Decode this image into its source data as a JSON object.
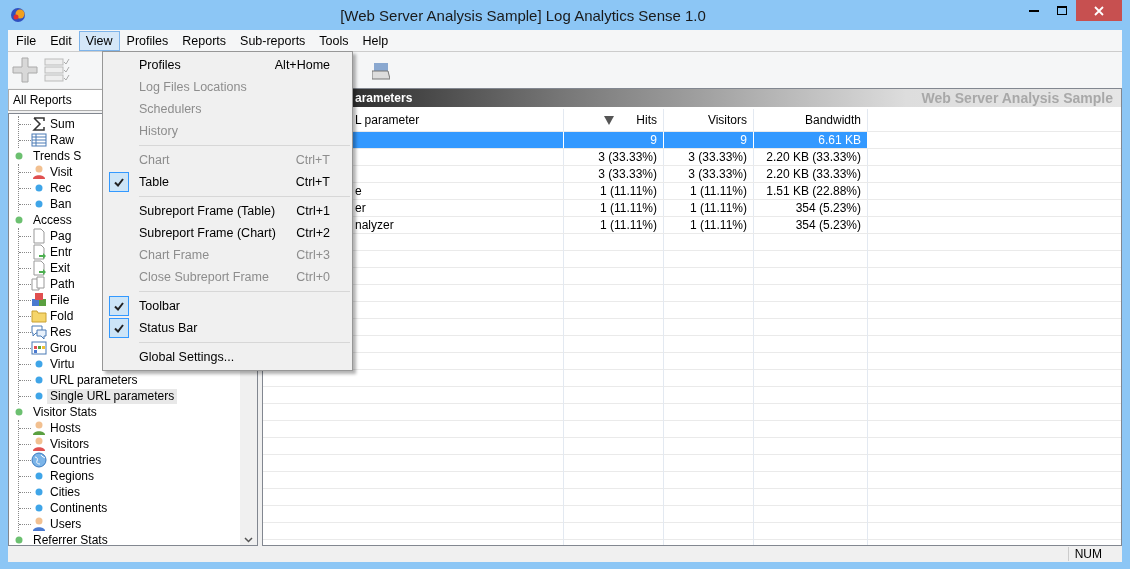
{
  "window": {
    "title": "[Web Server Analysis Sample] Log Analytics Sense 1.0"
  },
  "menubar": [
    {
      "label": "File",
      "selected": false
    },
    {
      "label": "Edit",
      "selected": false
    },
    {
      "label": "View",
      "selected": true
    },
    {
      "label": "Profiles",
      "selected": false
    },
    {
      "label": "Reports",
      "selected": false
    },
    {
      "label": "Sub-reports",
      "selected": false
    },
    {
      "label": "Tools",
      "selected": false
    },
    {
      "label": "Help",
      "selected": false
    }
  ],
  "view_menu": [
    {
      "kind": "item",
      "label": "Profiles",
      "shortcut": "Alt+Home",
      "disabled": false,
      "checked": false
    },
    {
      "kind": "item",
      "label": "Log Files Locations",
      "disabled": true,
      "checked": false
    },
    {
      "kind": "item",
      "label": "Schedulers",
      "disabled": true,
      "checked": false
    },
    {
      "kind": "item",
      "label": "History",
      "disabled": true,
      "checked": false
    },
    {
      "kind": "separator"
    },
    {
      "kind": "item",
      "label": "Chart",
      "shortcut": "Ctrl+T",
      "disabled": true,
      "checked": false
    },
    {
      "kind": "item",
      "label": "Table",
      "shortcut": "Ctrl+T",
      "disabled": false,
      "checked": true
    },
    {
      "kind": "separator"
    },
    {
      "kind": "item",
      "label": "Subreport Frame (Table)",
      "shortcut": "Ctrl+1",
      "disabled": false,
      "checked": false
    },
    {
      "kind": "item",
      "label": "Subreport Frame (Chart)",
      "shortcut": "Ctrl+2",
      "disabled": false,
      "checked": false
    },
    {
      "kind": "item",
      "label": "Chart Frame",
      "shortcut": "Ctrl+3",
      "disabled": true,
      "checked": false
    },
    {
      "kind": "item",
      "label": "Close Subreport Frame",
      "shortcut": "Ctrl+0",
      "disabled": true,
      "checked": false
    },
    {
      "kind": "separator"
    },
    {
      "kind": "item",
      "label": "Toolbar",
      "disabled": false,
      "checked": true
    },
    {
      "kind": "item",
      "label": "Status Bar",
      "disabled": false,
      "checked": true
    },
    {
      "kind": "separator"
    },
    {
      "kind": "item",
      "label": "Global Settings...",
      "disabled": false,
      "checked": false
    }
  ],
  "sidebar": {
    "report_select": "All Reports",
    "tree": [
      {
        "children": [
          {
            "label": "Sum",
            "kind": "sigma",
            "selected": false
          },
          {
            "label": "Raw",
            "kind": "table",
            "selected": false
          }
        ]
      },
      {
        "label": "Trends S",
        "children": [
          {
            "label": "Visit",
            "kind": "person-red",
            "selected": false
          },
          {
            "label": "Rec",
            "kind": "dot",
            "selected": false
          },
          {
            "label": "Ban",
            "kind": "dot",
            "selected": false
          }
        ]
      },
      {
        "label": "Access",
        "children": [
          {
            "label": "Pag",
            "kind": "page",
            "selected": false
          },
          {
            "label": "Entr",
            "kind": "page-up",
            "selected": false
          },
          {
            "label": "Exit",
            "kind": "page-arrow",
            "selected": false
          },
          {
            "label": "Path",
            "kind": "pages",
            "selected": false
          },
          {
            "label": "File",
            "kind": "cubes",
            "selected": false
          },
          {
            "label": "Fold",
            "kind": "folder",
            "selected": false
          },
          {
            "label": "Res",
            "kind": "chat",
            "selected": false
          },
          {
            "label": "Grou",
            "kind": "grid",
            "selected": false
          },
          {
            "label": "Virtu",
            "kind": "dot",
            "selected": false
          },
          {
            "label": "URL parameters",
            "kind": "dot",
            "selected": false
          },
          {
            "label": "Single URL parameters",
            "kind": "dot",
            "selected": true
          }
        ]
      },
      {
        "label": "Visitor Stats",
        "children": [
          {
            "label": "Hosts",
            "kind": "person-green",
            "selected": false
          },
          {
            "label": "Visitors",
            "kind": "person-red",
            "selected": false
          },
          {
            "label": "Countries",
            "kind": "globe",
            "selected": false
          },
          {
            "label": "Regions",
            "kind": "dot",
            "selected": false
          },
          {
            "label": "Cities",
            "kind": "dot",
            "selected": false
          },
          {
            "label": "Continents",
            "kind": "dot",
            "selected": false
          },
          {
            "label": "Users",
            "kind": "person-blue",
            "selected": false
          }
        ]
      },
      {
        "label": "Referrer Stats"
      }
    ]
  },
  "report": {
    "title": "arameters",
    "subtitle": "Web Server Analysis Sample",
    "columns": [
      {
        "label": "L parameter"
      },
      {
        "label": "Hits",
        "sorted": true
      },
      {
        "label": "Visitors",
        "sorted": false
      },
      {
        "label": "Bandwidth",
        "sorted": false
      }
    ],
    "rows": [
      {
        "cells": [
          "",
          "9",
          "9",
          "6.61 KB"
        ],
        "selected": true
      },
      {
        "cells": [
          "",
          "3 (33.33%)",
          "3 (33.33%)",
          "2.20 KB (33.33%)"
        ],
        "selected": false
      },
      {
        "cells": [
          "",
          "3 (33.33%)",
          "3 (33.33%)",
          "2.20 KB (33.33%)"
        ],
        "selected": false
      },
      {
        "cells": [
          "e",
          "1 (11.11%)",
          "1 (11.11%)",
          "1.51 KB (22.88%)"
        ],
        "selected": false
      },
      {
        "cells": [
          "er",
          "1 (11.11%)",
          "1 (11.11%)",
          "354 (5.23%)"
        ],
        "selected": false
      },
      {
        "cells": [
          "nalyzer",
          "1 (11.11%)",
          "1 (11.11%)",
          "354 (5.23%)"
        ],
        "selected": false
      }
    ]
  },
  "status_bar": {
    "indicator": "NUM"
  }
}
